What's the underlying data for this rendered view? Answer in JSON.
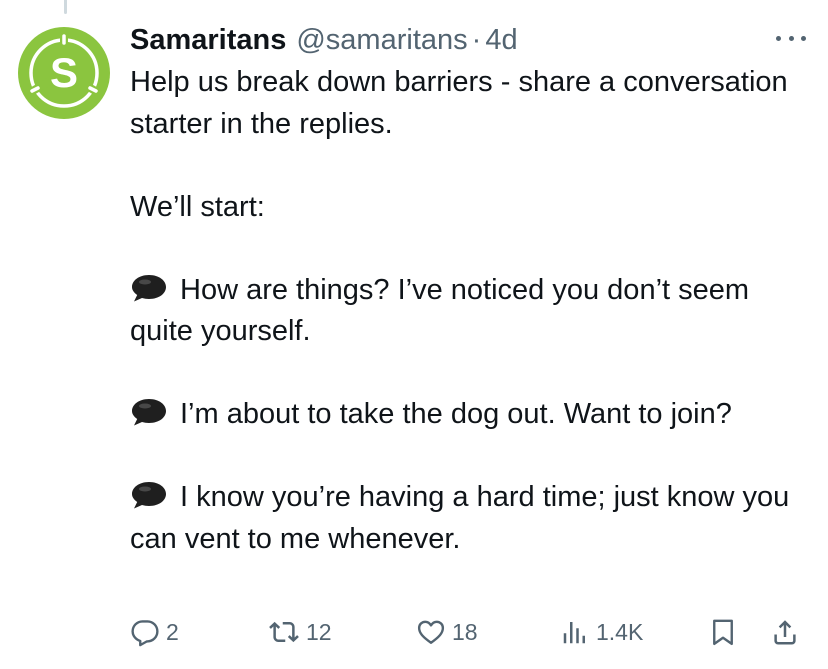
{
  "tweet": {
    "author_name": "Samaritans",
    "author_handle": "@samaritans",
    "separator": "·",
    "timestamp": "4d",
    "avatar_letter": "S",
    "brand_color": "#8bc53f",
    "text": {
      "line1": "Help us break down barriers - share a conversation starter in the replies.",
      "line2": "We’ll start:",
      "item1": "How are things? I’ve noticed you don’t seem quite yourself.",
      "item2": "I’m about to take the dog out. Want to join?",
      "item3": "I know you’re having a hard time; just know you can vent to me whenever."
    },
    "bullet_icon": "speech-balloon-icon"
  },
  "actions": {
    "replies": "2",
    "reposts": "12",
    "likes": "18",
    "views": "1.4K"
  },
  "colors": {
    "text": "#0f1419",
    "secondary": "#536471",
    "thread_line": "#cfd9de"
  }
}
